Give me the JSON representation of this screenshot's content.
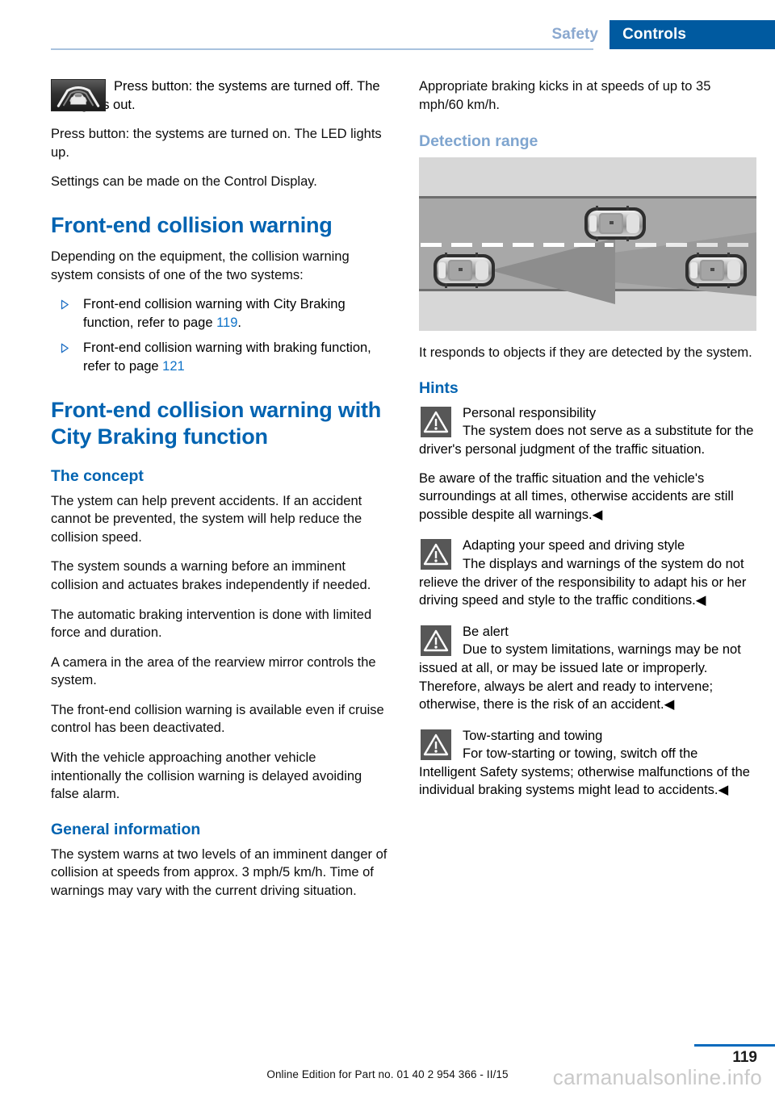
{
  "header": {
    "tab_inactive": "Safety",
    "tab_active": "Controls"
  },
  "left_column": {
    "button_icon_name": "lane-departure-button-icon",
    "icon_paragraph": "Press button: the systems are turned off. The LED goes out.",
    "para_led_on": "Press button: the systems are turned on. The LED lights up.",
    "para_settings": "Settings can be made on the Control Display.",
    "heading_front_end": "Front-end collision warning",
    "para_depending": "Depending on the equipment, the collision warning system consists of one of the two systems:",
    "bullets": [
      {
        "text_before": "Front-end collision warning with City Braking function, refer to page ",
        "page": "119",
        "text_after": "."
      },
      {
        "text_before": "Front-end collision warning with braking function, refer to page ",
        "page": "121",
        "text_after": ""
      }
    ],
    "heading_city_braking": "Front-end collision warning with City Braking function",
    "heading_concept": "The concept",
    "para_concept_1": "The ystem can help prevent accidents. If an accident cannot be prevented, the system will help reduce the collision speed.",
    "para_concept_2": "The system sounds a warning before an imminent collision and actuates brakes independently if needed.",
    "para_concept_3": "The automatic braking intervention is done with limited force and duration.",
    "para_concept_4": "A camera in the area of the rearview mirror controls the system.",
    "para_concept_5": "The front-end collision warning is available even if cruise control has been deactivated.",
    "para_concept_6": "With the vehicle approaching another vehicle intentionally the collision warning is delayed avoiding false alarm.",
    "heading_general": "General information",
    "para_general": "The system warns at two levels of an imminent danger of collision at speeds from approx. 3 mph/5 km/h. Time of warnings may vary with the current driving situation."
  },
  "right_column": {
    "para_braking": "Appropriate braking kicks in at speeds of up to 35 mph/60 km/h.",
    "heading_detection": "Detection range",
    "illustration_name": "detection-range-illustration",
    "para_responds": "It responds to objects if they are detected by the system.",
    "heading_hints": "Hints",
    "warnings": [
      {
        "title": "Personal responsibility",
        "body": "The system does not serve as a substitute for the driver's personal judgment of the traffic situation.",
        "body_cont": "Be aware of the traffic situation and the vehicle's surroundings at all times, otherwise accidents are still possible despite all warnings.◀"
      },
      {
        "title": "Adapting your speed and driving style",
        "body": "The displays and warnings of the system do not relieve the driver of the responsibility to adapt his or her driving speed and style to the traffic conditions.◀",
        "body_cont": ""
      },
      {
        "title": "Be alert",
        "body": "Due to system limitations, warnings may be not issued at all, or may be issued late or improperly. Therefore, always be alert and ready to intervene; otherwise, there is the risk of an accident.◀",
        "body_cont": ""
      },
      {
        "title": "Tow-starting and towing",
        "body": "For tow-starting or towing, switch off the Intelligent Safety systems; otherwise malfunctions of the individual braking systems might lead to accidents.◀",
        "body_cont": ""
      }
    ]
  },
  "footer": {
    "edition": "Online Edition for Part no. 01 40 2 954 366 - II/15",
    "page_number": "119",
    "watermark": "carmanualsonline.info"
  },
  "colors": {
    "brand_blue": "#005aa0",
    "heading_blue": "#0063b1",
    "light_blue": "#7fa5cf",
    "link_blue": "#0f73c8",
    "rule_blue": "#a8c2de"
  }
}
